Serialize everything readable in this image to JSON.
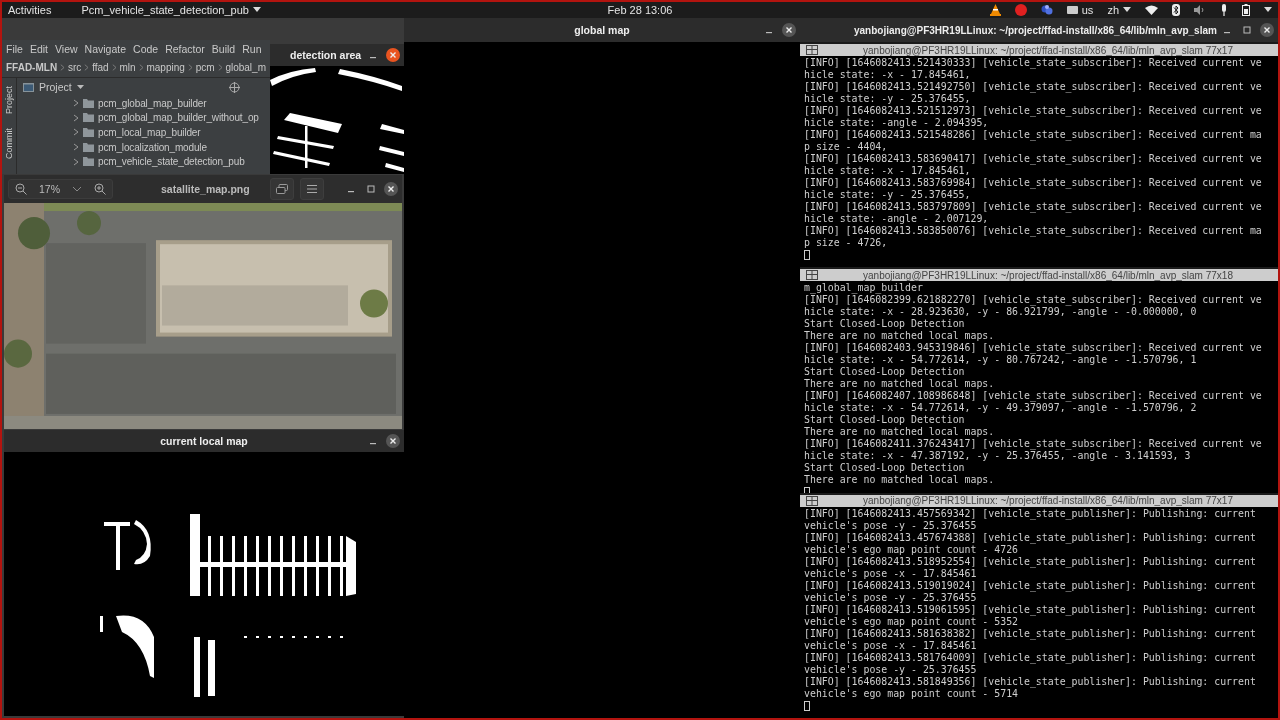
{
  "top_bar": {
    "activities": "Activities",
    "app_menu": "Pcm_vehicle_state_detection_pub",
    "clock": "Feb 28  13:06",
    "keyboard": "us",
    "input_method": "zh"
  },
  "ide": {
    "menu": [
      "File",
      "Edit",
      "View",
      "Navigate",
      "Code",
      "Refactor",
      "Build",
      "Run"
    ],
    "breadcrumb": [
      "FFAD-MLN",
      "src",
      "ffad",
      "mln",
      "mapping",
      "pcm",
      "global_m"
    ],
    "tool_window": "Project",
    "side_tabs": [
      "Project",
      "Commit"
    ],
    "tree": [
      {
        "label": "pcm_global_map_builder",
        "expanded": false
      },
      {
        "label": "pcm_global_map_builder_without_op",
        "expanded": false
      },
      {
        "label": "pcm_local_map_builder",
        "expanded": false
      },
      {
        "label": "pcm_localization_module",
        "expanded": false
      },
      {
        "label": "pcm_vehicle_state_detection_pub",
        "expanded": false
      }
    ]
  },
  "detection_window": {
    "title": "detection area",
    "focused": true
  },
  "image_viewer": {
    "zoom": "17%",
    "title": "satallite_map.png"
  },
  "local_map_window": {
    "title": "current local map"
  },
  "global_map_window": {
    "title": "global map"
  },
  "terminal_window": {
    "title": "yanbojiang@PF3HR19LLinux: ~/project/ffad-install/x86_64/lib/mln_avp_slam",
    "panes": [
      {
        "title": "yanbojiang@PF3HR19LLinux: ~/project/ffad-install/x86_64/lib/mln_avp_slam 77x17",
        "lines": [
          "[INFO] [1646082413.521430333] [vehicle_state_subscriber]: Received current ve",
          "hicle state: -x - 17.845461,",
          "[INFO] [1646082413.521492750] [vehicle_state_subscriber]: Received current ve",
          "hicle state: -y - 25.376455,",
          "[INFO] [1646082413.521512973] [vehicle_state_subscriber]: Received current ve",
          "hicle state: -angle - 2.094395,",
          "[INFO] [1646082413.521548286] [vehicle_state_subscriber]: Received current ma",
          "p size - 4404,",
          "[INFO] [1646082413.583690417] [vehicle_state_subscriber]: Received current ve",
          "hicle state: -x - 17.845461,",
          "[INFO] [1646082413.583769984] [vehicle_state_subscriber]: Received current ve",
          "hicle state: -y - 25.376455,",
          "[INFO] [1646082413.583797809] [vehicle_state_subscriber]: Received current ve",
          "hicle state: -angle - 2.007129,",
          "[INFO] [1646082413.583850076] [vehicle_state_subscriber]: Received current ma",
          "p size - 4726,"
        ]
      },
      {
        "title": "yanbojiang@PF3HR19LLinux: ~/project/ffad-install/x86_64/lib/mln_avp_slam 77x18",
        "lines": [
          "m_global_map_builder",
          "[INFO] [1646082399.621882270] [vehicle_state_subscriber]: Received current ve",
          "hicle state: -x - 28.923630, -y - 86.921799, -angle - -0.000000, 0",
          "Start Closed-Loop Detection",
          "There are no matched local maps.",
          "[INFO] [1646082403.945319846] [vehicle_state_subscriber]: Received current ve",
          "hicle state: -x - 54.772614, -y - 80.767242, -angle - -1.570796, 1",
          "Start Closed-Loop Detection",
          "There are no matched local maps.",
          "[INFO] [1646082407.108986848] [vehicle_state_subscriber]: Received current ve",
          "hicle state: -x - 54.772614, -y - 49.379097, -angle - -1.570796, 2",
          "Start Closed-Loop Detection",
          "There are no matched local maps.",
          "[INFO] [1646082411.376243417] [vehicle_state_subscriber]: Received current ve",
          "hicle state: -x - 47.387192, -y - 25.376455, -angle - 3.141593, 3",
          "Start Closed-Loop Detection",
          "There are no matched local maps."
        ]
      },
      {
        "title": "yanbojiang@PF3HR19LLinux: ~/project/ffad-install/x86_64/lib/mln_avp_slam 77x17",
        "lines": [
          "[INFO] [1646082413.457569342] [vehicle_state_publisher]: Publishing: current",
          "vehicle's pose -y - 25.376455",
          "[INFO] [1646082413.457674388] [vehicle_state_publisher]: Publishing: current",
          "vehicle's ego map point count - 4726",
          "[INFO] [1646082413.518952554] [vehicle_state_publisher]: Publishing: current",
          "vehicle's pose -x - 17.845461",
          "[INFO] [1646082413.519019024] [vehicle_state_publisher]: Publishing: current",
          "vehicle's pose -y - 25.376455",
          "[INFO] [1646082413.519061595] [vehicle_state_publisher]: Publishing: current",
          "vehicle's ego map point count - 5352",
          "[INFO] [1646082413.581638382] [vehicle_state_publisher]: Publishing: current",
          "vehicle's pose -x - 17.845461",
          "[INFO] [1646082413.581764009] [vehicle_state_publisher]: Publishing: current",
          "vehicle's pose -y - 25.376455",
          "[INFO] [1646082413.581849356] [vehicle_state_publisher]: Publishing: current",
          "vehicle's ego map point count - 5714"
        ]
      }
    ]
  }
}
